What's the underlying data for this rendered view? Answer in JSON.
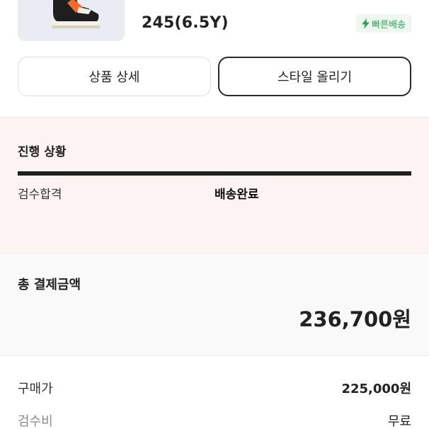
{
  "product": {
    "size": "245(6.5Y)",
    "badge_label": "빠른배송",
    "badge_icon": "lightning-icon",
    "badge_color": "#2ba05a"
  },
  "actions": {
    "detail_label": "상품 상세",
    "style_label": "스타일 올리기"
  },
  "progress": {
    "title": "진행 상황",
    "steps": [
      "검수합격",
      "배송완료"
    ],
    "current_step": "배송완료"
  },
  "payment": {
    "total_label": "총 결제금액",
    "total_value": "236,700원",
    "breakdown": [
      {
        "label": "구매가",
        "value": "225,000원"
      },
      {
        "label": "검수비",
        "value": "무료"
      }
    ]
  },
  "colors": {
    "progress_bg": "#fdf3f2",
    "total_bg": "#f9f9f9"
  }
}
